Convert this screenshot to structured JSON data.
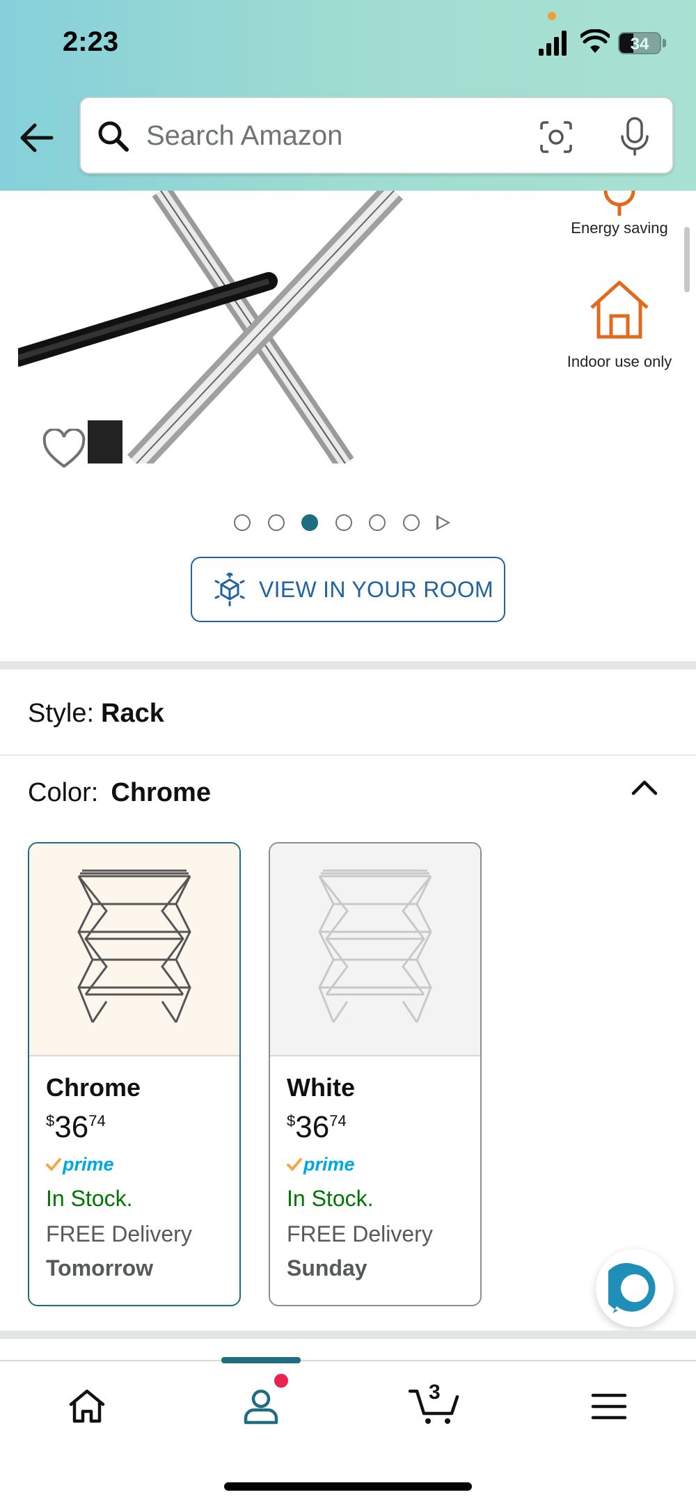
{
  "status_bar": {
    "time": "2:23",
    "battery": "34"
  },
  "search": {
    "placeholder": "Search Amazon"
  },
  "features": [
    {
      "label": "Energy saving",
      "icon": "plug-icon"
    },
    {
      "label": "Indoor use only",
      "icon": "house-icon"
    }
  ],
  "carousel": {
    "count": 6,
    "active_index": 2
  },
  "view_in_room": {
    "label": "VIEW IN YOUR ROOM"
  },
  "style": {
    "label": "Style:",
    "value": "Rack"
  },
  "color": {
    "label": "Color:",
    "value": "Chrome"
  },
  "swatches": [
    {
      "name": "Chrome",
      "currency": "$",
      "price_whole": "36",
      "price_fraction": "74",
      "prime": "prime",
      "stock": "In Stock.",
      "delivery": "FREE Delivery",
      "delivery_day": "Tomorrow"
    },
    {
      "name": "White",
      "currency": "$",
      "price_whole": "36",
      "price_fraction": "74",
      "prime": "prime",
      "stock": "In Stock.",
      "delivery": "FREE Delivery",
      "delivery_day": "Sunday"
    }
  ],
  "nav": {
    "cart_count": "3"
  },
  "colors": {
    "accent": "#1f6d80",
    "link": "#2162a1",
    "in_stock": "#007600",
    "prime": "#00a8e1",
    "feature_icon": "#e06a1e"
  }
}
